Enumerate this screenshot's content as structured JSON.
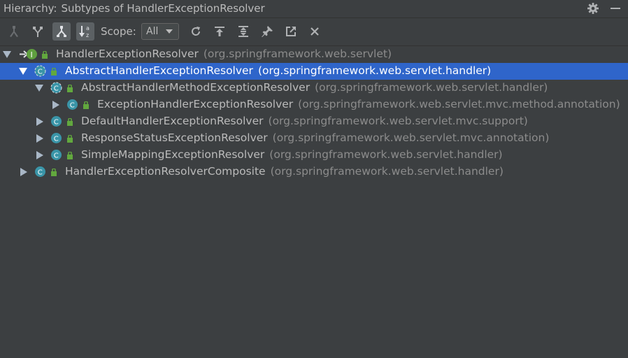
{
  "title": {
    "label": "Hierarchy:",
    "subtitle": "Subtypes of HandlerExceptionResolver"
  },
  "window_actions": [
    {
      "icon": "gear-icon"
    },
    {
      "icon": "minimize-icon"
    }
  ],
  "toolbar": {
    "scope_label": "Scope:",
    "scope_value": "All",
    "buttons": [
      {
        "icon": "type-hierarchy-icon",
        "pressed": false
      },
      {
        "icon": "supertypes-hierarchy-icon",
        "pressed": false
      },
      {
        "icon": "subtypes-hierarchy-icon",
        "pressed": true
      },
      {
        "icon": "sort-alphabetically-icon",
        "pressed": true
      },
      {
        "icon": "refresh-icon",
        "pressed": false
      },
      {
        "icon": "base-on-this-class-icon",
        "pressed": false
      },
      {
        "icon": "expand-all-icon",
        "pressed": false
      },
      {
        "icon": "pin-icon",
        "pressed": false
      },
      {
        "icon": "export-icon",
        "pressed": false
      },
      {
        "icon": "close-icon",
        "pressed": false
      }
    ]
  },
  "tree": [
    {
      "name": "HandlerExceptionResolver",
      "package": "(org.springframework.web.servlet)",
      "kind": "interface",
      "expanded": true,
      "selected": false
    },
    {
      "name": "AbstractHandlerExceptionResolver",
      "package": "(org.springframework.web.servlet.handler)",
      "kind": "abstract-class",
      "expanded": true,
      "selected": true
    },
    {
      "name": "AbstractHandlerMethodExceptionResolver",
      "package": "(org.springframework.web.servlet.handler)",
      "kind": "abstract-class",
      "expanded": true,
      "selected": false
    },
    {
      "name": "ExceptionHandlerExceptionResolver",
      "package": "(org.springframework.web.servlet.mvc.method.annotation)",
      "kind": "class",
      "expanded": false,
      "selected": false
    },
    {
      "name": "DefaultHandlerExceptionResolver",
      "package": "(org.springframework.web.servlet.mvc.support)",
      "kind": "class",
      "expanded": false,
      "selected": false
    },
    {
      "name": "ResponseStatusExceptionResolver",
      "package": "(org.springframework.web.servlet.mvc.annotation)",
      "kind": "class",
      "expanded": false,
      "selected": false
    },
    {
      "name": "SimpleMappingExceptionResolver",
      "package": "(org.springframework.web.servlet.handler)",
      "kind": "class",
      "expanded": false,
      "selected": false
    },
    {
      "name": "HandlerExceptionResolverComposite",
      "package": "(org.springframework.web.servlet.handler)",
      "kind": "class",
      "expanded": false,
      "selected": false
    }
  ],
  "colors": {
    "background": "#3c3f41",
    "selection": "#2f65ca",
    "class_icon": "#3a95a8",
    "interface_icon": "#5f9f3f",
    "lock": "#62a83e"
  }
}
